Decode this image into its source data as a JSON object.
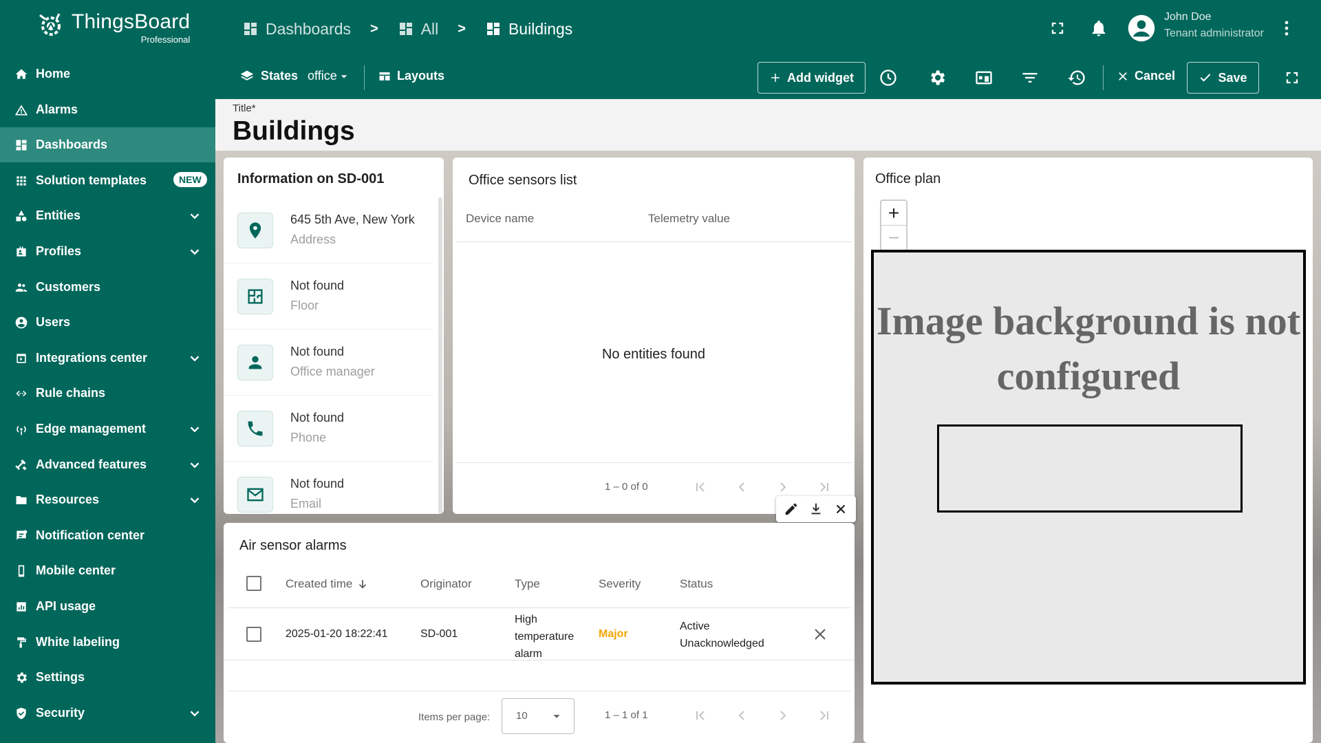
{
  "app": {
    "name": "ThingsBoard",
    "edition": "Professional"
  },
  "breadcrumb": [
    {
      "label": "Dashboards"
    },
    {
      "label": "All"
    },
    {
      "label": "Buildings"
    }
  ],
  "breadcrumb_sep": ">",
  "user": {
    "name": "John Doe",
    "role": "Tenant administrator"
  },
  "sidebar": {
    "items": [
      {
        "label": "Home",
        "icon": "home-icon"
      },
      {
        "label": "Alarms",
        "icon": "alarm-icon"
      },
      {
        "label": "Dashboards",
        "icon": "dashboard-icon",
        "active": true
      },
      {
        "label": "Solution templates",
        "icon": "apps-icon",
        "badge": "NEW"
      },
      {
        "label": "Entities",
        "icon": "entities-icon",
        "expandable": true
      },
      {
        "label": "Profiles",
        "icon": "profiles-icon",
        "expandable": true
      },
      {
        "label": "Customers",
        "icon": "customers-icon"
      },
      {
        "label": "Users",
        "icon": "users-icon"
      },
      {
        "label": "Integrations center",
        "icon": "integrations-icon",
        "expandable": true
      },
      {
        "label": "Rule chains",
        "icon": "rule-chains-icon"
      },
      {
        "label": "Edge management",
        "icon": "edge-icon",
        "expandable": true
      },
      {
        "label": "Advanced features",
        "icon": "advanced-icon",
        "expandable": true
      },
      {
        "label": "Resources",
        "icon": "folder-icon",
        "expandable": true
      },
      {
        "label": "Notification center",
        "icon": "notification-icon"
      },
      {
        "label": "Mobile center",
        "icon": "mobile-icon"
      },
      {
        "label": "API usage",
        "icon": "api-usage-icon"
      },
      {
        "label": "White labeling",
        "icon": "paint-roller-icon"
      },
      {
        "label": "Settings",
        "icon": "gear-icon"
      },
      {
        "label": "Security",
        "icon": "shield-icon",
        "expandable": true
      }
    ]
  },
  "toolbar": {
    "states_label": "States",
    "state_value": "office",
    "layouts_label": "Layouts",
    "add_widget_label": "Add widget",
    "cancel_label": "Cancel",
    "save_label": "Save"
  },
  "title_field": {
    "label": "Title*",
    "value": "Buildings"
  },
  "widgets": {
    "info": {
      "title": "Information on SD-001",
      "rows": [
        {
          "value": "645 5th Ave, New York",
          "label": "Address",
          "icon": "location-pin-icon"
        },
        {
          "value": "Not found",
          "label": "Floor",
          "icon": "floor-plan-icon"
        },
        {
          "value": "Not found",
          "label": "Office manager",
          "icon": "person-icon"
        },
        {
          "value": "Not found",
          "label": "Phone",
          "icon": "phone-icon"
        },
        {
          "value": "Not found",
          "label": "Email",
          "icon": "mail-icon"
        }
      ]
    },
    "sensors": {
      "title": "Office sensors list",
      "columns": [
        "Device name",
        "Telemetry value"
      ],
      "empty_text": "No entities found",
      "pagination": "1 – 0 of 0"
    },
    "plan": {
      "title": "Office plan",
      "zoom_in": "+",
      "zoom_out": "−",
      "placeholder": "Image background is not configured"
    },
    "alarms": {
      "title": "Air sensor alarms",
      "columns": [
        "Created time",
        "Originator",
        "Type",
        "Severity",
        "Status"
      ],
      "rows": [
        {
          "created": "2025-01-20 18:22:41",
          "originator": "SD-001",
          "type": "High temperature alarm",
          "severity": "Major",
          "status": "Active Unacknowledged"
        }
      ],
      "items_per_page_label": "Items per page:",
      "items_per_page": "10",
      "pagination": "1 – 1 of 1"
    }
  },
  "colors": {
    "brand": "#02675b",
    "sidebar_active": "#2e8a7e",
    "severity_major": "#f2a500"
  }
}
